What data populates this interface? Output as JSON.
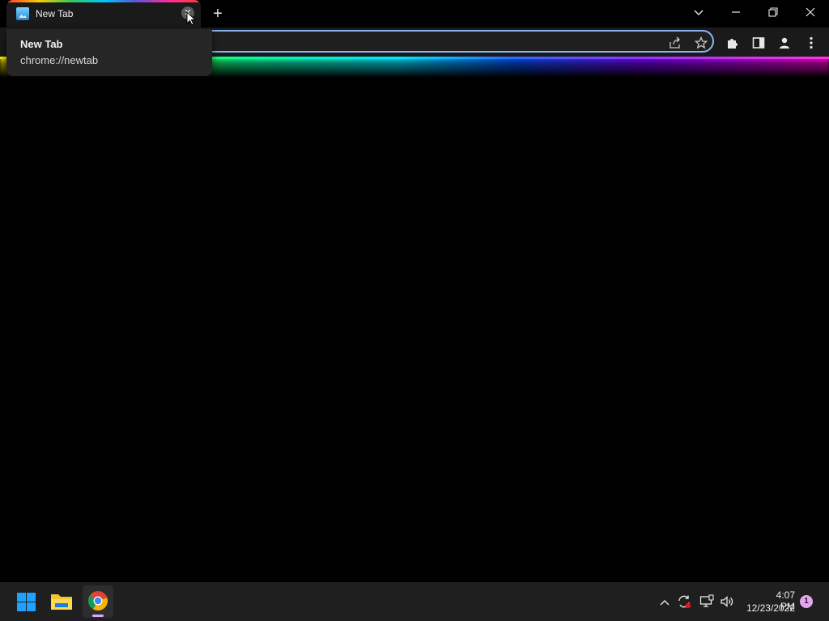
{
  "browser": {
    "tab": {
      "title": "New Tab",
      "close_label": "✕",
      "favicon": "landscape-favicon-icon"
    },
    "new_tab_label": "+",
    "window_controls": {
      "tab_search": "⌄",
      "minimize": "—",
      "restore": "❐",
      "close": "✕"
    },
    "toolbar": {
      "share_icon": "share-icon",
      "bookmark_icon": "star-icon",
      "extensions_icon": "puzzle-icon",
      "side_panel_icon": "side-panel-icon",
      "profile_icon": "person-icon",
      "menu_icon": "kebab-menu-icon"
    },
    "hover_card": {
      "title": "New Tab",
      "url": "chrome://newtab"
    },
    "accent_colors": {
      "omnibox_focus": "#8ab4f8",
      "neon_start": "#ffe600",
      "neon_end": "#ff33e0"
    }
  },
  "taskbar": {
    "pinned": [
      "windows-start-icon",
      "file-explorer-icon",
      "chrome-icon"
    ],
    "tray": {
      "chevron": "^",
      "sync": "⟳",
      "network": "🖵",
      "volume": "🔊"
    },
    "clock": {
      "time": "4:07 PM",
      "date": "12/23/2022"
    },
    "notification_count": "1"
  }
}
